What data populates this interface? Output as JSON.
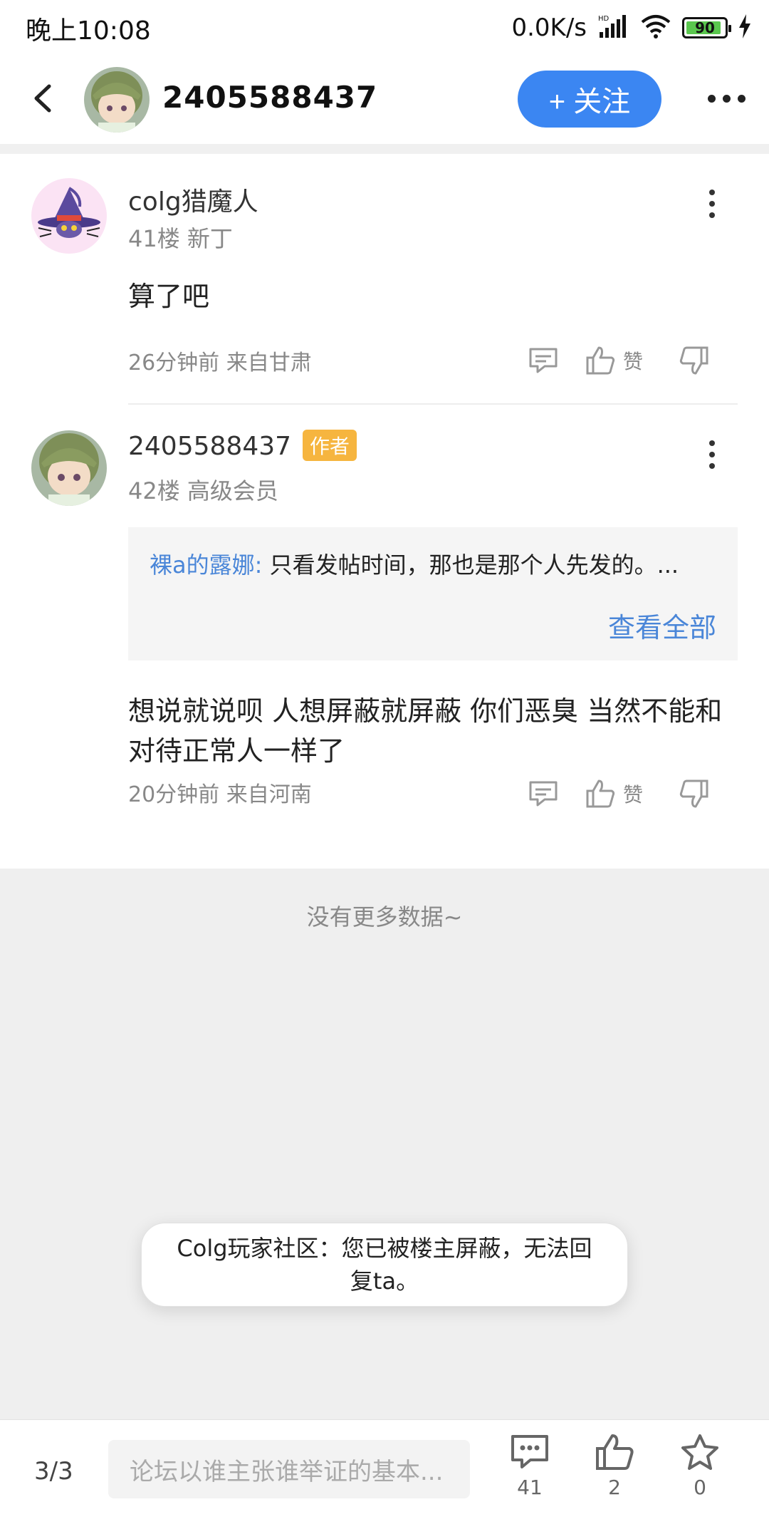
{
  "status_bar": {
    "time": "晚上10:08",
    "net_speed": "0.0K/s",
    "battery": "90"
  },
  "header": {
    "username": "2405588437",
    "follow_label": "+ 关注"
  },
  "posts": [
    {
      "username": "colg猎魔人",
      "floor_info": "41楼 新丁",
      "content": "算了吧",
      "time_location": "26分钟前 来自甘肃",
      "like_label": "赞"
    },
    {
      "username": "2405588437",
      "author_badge": "作者",
      "floor_info": "42楼 高级会员",
      "quote": {
        "name": "裸a的露娜:",
        "text": " 只看发帖时间，那也是那个人先发的。...",
        "view_all": "查看全部"
      },
      "content": "想说就说呗 人想屏蔽就屏蔽 你们恶臭 当然不能和对待正常人一样了",
      "time_location": "20分钟前 来自河南",
      "like_label": "赞"
    }
  ],
  "list_end": "没有更多数据~",
  "toast": "Colg玩家社区：您已被楼主屏蔽，无法回复ta。",
  "bottom_bar": {
    "page": "3/3",
    "reply_placeholder": "论坛以谁主张谁举证的基本...",
    "comment_count": "41",
    "like_count": "2",
    "star_count": "0"
  },
  "colors": {
    "accent": "#3b86f2",
    "link": "#4a86d8",
    "badge": "#f6b53f"
  }
}
